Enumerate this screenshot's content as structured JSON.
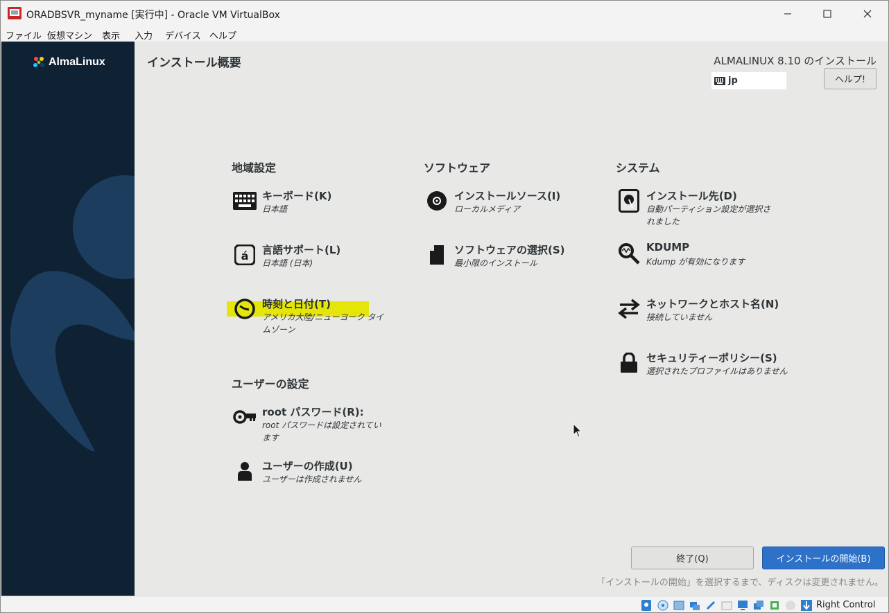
{
  "window": {
    "title": "ORADBSVR_myname [実行中] - Oracle VM VirtualBox"
  },
  "menubar": {
    "items": [
      {
        "label": "ファイル"
      },
      {
        "label": "仮想マシン"
      },
      {
        "label": "表示"
      },
      {
        "label": "入力"
      },
      {
        "label": "デバイス"
      },
      {
        "label": "ヘルプ"
      }
    ]
  },
  "installer": {
    "logo_text": "AlmaLinux",
    "summary_title": "インストール概要",
    "product_title": "ALMALINUX 8.10 のインストール",
    "keyboard_layout": "jp",
    "help_label": "ヘルプ!",
    "sections": {
      "localization": "地域設定",
      "software": "ソフトウェア",
      "system": "システム",
      "user_settings": "ユーザーの設定"
    },
    "spokes": {
      "keyboard": {
        "title": "キーボード(K)",
        "status": "日本語"
      },
      "language": {
        "title": "言語サポート(L)",
        "status": "日本語 (日本)"
      },
      "time": {
        "title": "時刻と日付(T)",
        "status": "アメリカ大陸/ニューヨーク タイムゾーン"
      },
      "source": {
        "title": "インストールソース(I)",
        "status": "ローカルメディア"
      },
      "software": {
        "title": "ソフトウェアの選択(S)",
        "status": "最小限のインストール"
      },
      "destination": {
        "title": "インストール先(D)",
        "status": "自動パーティション設定が選択されました"
      },
      "kdump": {
        "title": "KDUMP",
        "status": "Kdump が有効になります"
      },
      "network": {
        "title": "ネットワークとホスト名(N)",
        "status": "接続していません"
      },
      "security": {
        "title": "セキュリティーポリシー(S)",
        "status": "選択されたプロファイルはありません"
      },
      "root": {
        "title": "root パスワード(R):",
        "status": "root パスワードは設定されています"
      },
      "user": {
        "title": "ユーザーの作成(U)",
        "status": "ユーザーは作成されません"
      }
    },
    "quit_label": "終了(Q)",
    "begin_label": "インストールの開始(B)",
    "footer_note": "「インストールの開始」を選択するまで、ディスクは変更されません。",
    "colors": {
      "sidebar": "#0f2233",
      "highlight": "#e5e50a",
      "primary_button": "#2d72c8"
    }
  },
  "statusbar": {
    "host_key": "Right Control"
  }
}
